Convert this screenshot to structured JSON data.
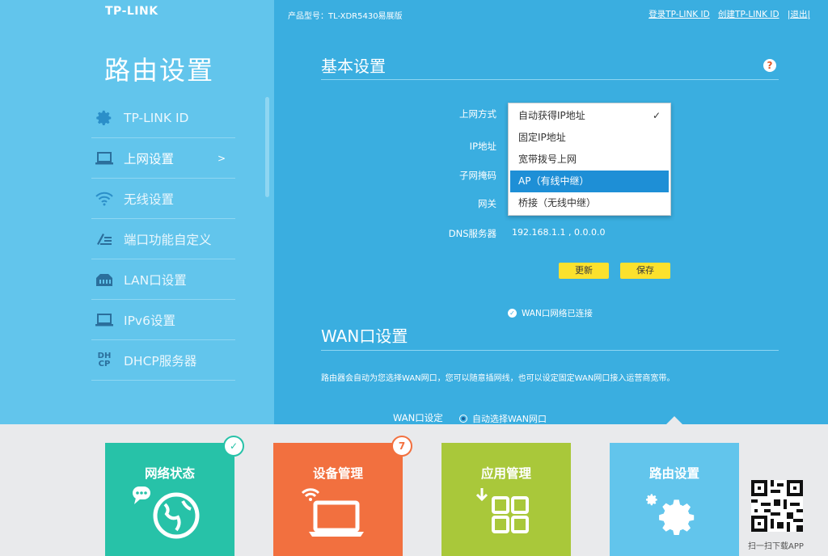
{
  "brand": "TP-LINK",
  "header": {
    "model": "产品型号：TL-XDR5430易展版",
    "links": [
      "登录TP-LINK ID",
      "创建TP-LINK ID",
      "退出"
    ]
  },
  "sidebar": {
    "title": "路由设置",
    "items": [
      {
        "label": "TP-LINK ID",
        "icon": "gear-icon"
      },
      {
        "label": "上网设置",
        "icon": "laptop-icon",
        "arrow": ">"
      },
      {
        "label": "无线设置",
        "icon": "wifi-icon"
      },
      {
        "label": "端口功能自定义",
        "icon": "port-custom-icon"
      },
      {
        "label": "LAN口设置",
        "icon": "lan-icon"
      },
      {
        "label": "IPv6设置",
        "icon": "laptop-icon"
      },
      {
        "label": "DHCP服务器",
        "icon": "dhcp-icon",
        "icon_text": [
          "DH",
          "CP"
        ]
      }
    ]
  },
  "basic": {
    "title": "基本设置",
    "help": "?",
    "labels": {
      "conn_type": "上网方式",
      "ip": "IP地址",
      "mask": "子网掩码",
      "gateway": "网关",
      "dns": "DNS服务器"
    },
    "dns_value": "192.168.1.1 , 0.0.0.0",
    "dropdown": {
      "options": [
        "自动获得IP地址",
        "固定IP地址",
        "宽带拨号上网",
        "AP（有线中继）",
        "桥接（无线中继）"
      ],
      "checked_index": 0,
      "highlighted_index": 3,
      "check": "✓"
    },
    "buttons": {
      "refresh": "更新",
      "save": "保存"
    },
    "status": "WAN口网络已连接"
  },
  "wan": {
    "title": "WAN口设置",
    "description": "路由器会自动为您选择WAN网口，您可以随意插网线，也可以设定固定WAN网口接入运营商宽带。",
    "setting_label": "WAN口设定",
    "radio_label": "自动选择WAN网口"
  },
  "tiles": [
    {
      "label": "网络状态",
      "color": "#27c2a8",
      "badge": "✓",
      "badge_color": "#27c2a8"
    },
    {
      "label": "设备管理",
      "color": "#f2703f",
      "badge": "7",
      "badge_color": "#f2703f"
    },
    {
      "label": "应用管理",
      "color": "#a9c83a"
    },
    {
      "label": "路由设置",
      "color": "#62c5ec"
    }
  ],
  "qr_caption": "扫一扫下载APP",
  "colors": {
    "sidebar_bg": "#62c5ec",
    "main_bg": "#3aaee0",
    "button_yellow": "#fbe12d",
    "highlight_blue": "#1e8fd6"
  }
}
